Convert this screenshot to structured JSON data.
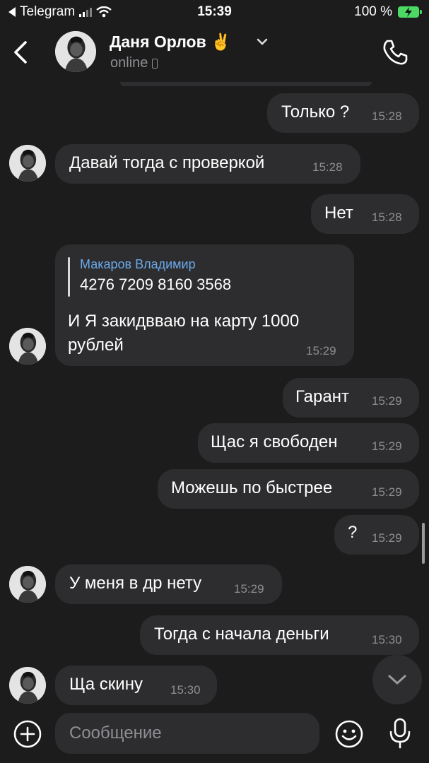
{
  "status_bar": {
    "app_back": "Telegram",
    "time": "15:39",
    "battery": "100 %"
  },
  "header": {
    "name": "Даня Орлов ✌️",
    "status": "online"
  },
  "messages": [
    {
      "dir": "out",
      "text": "Только ?",
      "time": "15:28"
    },
    {
      "dir": "in",
      "text": "Давай тогда с проверкой",
      "time": "15:28"
    },
    {
      "dir": "out",
      "text": "Нет",
      "time": "15:28"
    },
    {
      "dir": "in",
      "reply_name": "Макаров Владимир",
      "reply_text": "4276 7209 8160 3568",
      "text": "И Я закидвваю на карту 1000 рублей",
      "time": "15:29"
    },
    {
      "dir": "out",
      "text": "Гарант",
      "time": "15:29"
    },
    {
      "dir": "out",
      "text": "Щас я свободен",
      "time": "15:29"
    },
    {
      "dir": "out",
      "text": "Можешь по быстрее",
      "time": "15:29"
    },
    {
      "dir": "out",
      "text": "?",
      "time": "15:29"
    },
    {
      "dir": "in",
      "text": "У меня в др нету",
      "time": "15:29"
    },
    {
      "dir": "out",
      "text": "Тогда с начала деньги",
      "time": "15:30"
    },
    {
      "dir": "in",
      "text": "Ща скину",
      "time": "15:30"
    }
  ],
  "input": {
    "placeholder": "Сообщение"
  }
}
